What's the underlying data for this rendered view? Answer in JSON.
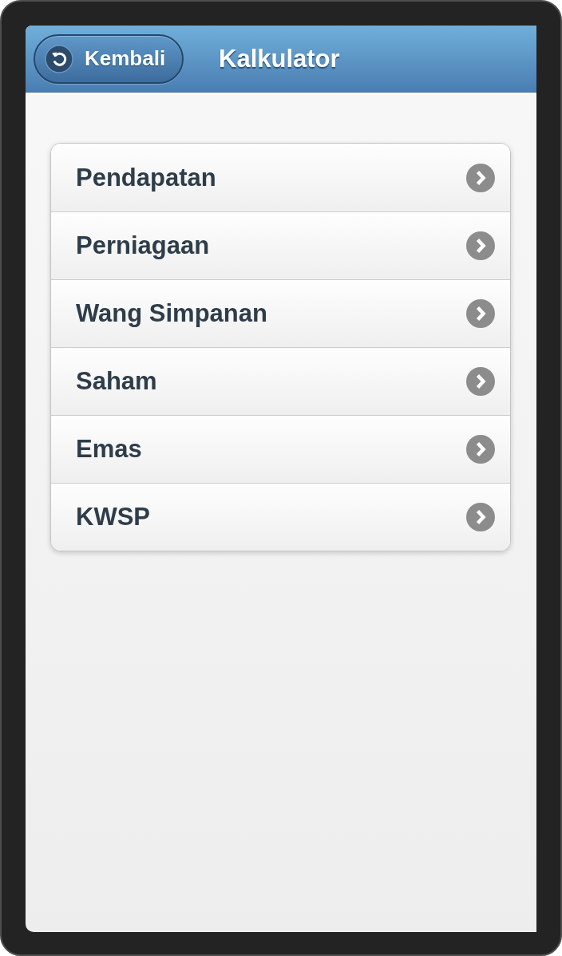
{
  "header": {
    "back_button": {
      "label": "Kembali"
    },
    "title": "Kalkulator"
  },
  "menu": {
    "items": [
      {
        "label": "Pendapatan"
      },
      {
        "label": "Perniagaan"
      },
      {
        "label": "Wang Simpanan"
      },
      {
        "label": "Saham"
      },
      {
        "label": "Emas"
      },
      {
        "label": "KWSP"
      }
    ]
  }
}
